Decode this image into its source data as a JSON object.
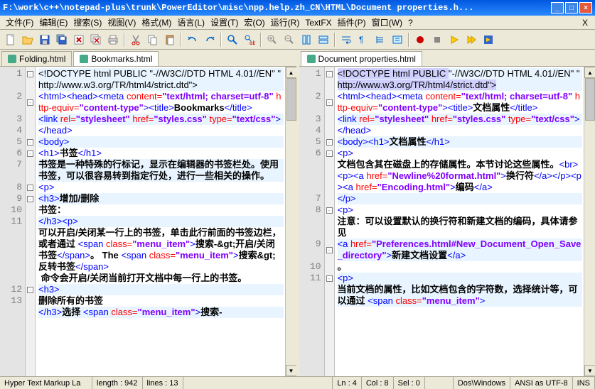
{
  "title": "F:\\work\\c++\\notepad-plus\\trunk\\PowerEditor\\misc\\npp.help.zh_CN\\HTML\\Document properties.h...",
  "menus": [
    "文件(F)",
    "编辑(E)",
    "搜索(S)",
    "视图(V)",
    "格式(M)",
    "语言(L)",
    "设置(T)",
    "宏(O)",
    "运行(R)",
    "TextFX",
    "插件(P)",
    "窗口(W)",
    "?"
  ],
  "tabs_left": [
    {
      "label": "Folding.html",
      "active": false
    },
    {
      "label": "Bookmarks.html",
      "active": true
    }
  ],
  "tabs_right": [
    {
      "label": "Document properties.html",
      "active": true
    }
  ],
  "status": {
    "lang": "Hyper Text Markup La",
    "length": "length : 942",
    "lines": "lines : 13",
    "ln": "Ln : 4",
    "col": "Col : 8",
    "sel": "Sel : 0",
    "eol": "Dos\\Windows",
    "enc": "ANSI as UTF-8",
    "mode": "INS"
  },
  "left_code": [
    {
      "n": 1,
      "alt": true,
      "fold": "-",
      "segs": [
        {
          "c": "t-doc",
          "t": "<!DOCTYPE html PUBLIC \"-//W3C//DTD HTML 4.01//EN\" \""
        }
      ]
    },
    {
      "n": "",
      "alt": true,
      "segs": [
        {
          "c": "t-doc",
          "t": "http://www.w3.org/TR/html4/strict.dtd\">"
        }
      ]
    },
    {
      "n": 2,
      "alt": false,
      "fold": "-",
      "segs": [
        {
          "c": "t-tag",
          "t": "<html><head><meta"
        },
        {
          "c": "",
          "t": " "
        },
        {
          "c": "t-attr",
          "t": "content="
        },
        {
          "c": "t-str",
          "t": "\"text/html; charset=utf-8\""
        },
        {
          "c": "",
          "t": " "
        },
        {
          "c": "t-attr",
          "t": "http-equiv="
        },
        {
          "c": "t-str",
          "t": "\"content-type\""
        },
        {
          "c": "t-tag",
          "t": "><title>"
        },
        {
          "c": "t-txt",
          "t": "Bookmarks"
        },
        {
          "c": "t-tag",
          "t": "</title>"
        }
      ]
    },
    {
      "n": 3,
      "alt": true,
      "segs": [
        {
          "c": "t-tag",
          "t": "<link"
        },
        {
          "c": "",
          "t": " "
        },
        {
          "c": "t-attr",
          "t": "rel="
        },
        {
          "c": "t-str",
          "t": "\"stylesheet\""
        },
        {
          "c": "",
          "t": " "
        },
        {
          "c": "t-attr",
          "t": "href="
        },
        {
          "c": "t-str",
          "t": "\"styles.css\""
        },
        {
          "c": "",
          "t": " "
        },
        {
          "c": "t-attr",
          "t": "type="
        },
        {
          "c": "t-str",
          "t": "\"text/css\""
        },
        {
          "c": "t-tag",
          "t": ">"
        }
      ]
    },
    {
      "n": 4,
      "alt": false,
      "segs": [
        {
          "c": "t-tag",
          "t": "</head>"
        }
      ]
    },
    {
      "n": 5,
      "alt": true,
      "fold": "-",
      "segs": [
        {
          "c": "t-tag",
          "t": "<body>"
        }
      ]
    },
    {
      "n": 6,
      "alt": false,
      "fold": "-",
      "segs": [
        {
          "c": "t-tag",
          "t": "<h1>"
        },
        {
          "c": "t-txt",
          "t": "书签"
        },
        {
          "c": "t-tag",
          "t": "</h1>"
        }
      ]
    },
    {
      "n": 7,
      "alt": true,
      "segs": [
        {
          "c": "t-txt",
          "t": "书签是一种特殊的行标记，显示在编辑器的书签栏处。使用书签，可以很容易转到指定行处，进行一些相关的操作。"
        }
      ]
    },
    {
      "n": 8,
      "alt": false,
      "fold": "-",
      "segs": [
        {
          "c": "t-tag",
          "t": "<p>"
        }
      ]
    },
    {
      "n": 9,
      "alt": true,
      "fold": "-",
      "segs": [
        {
          "c": "t-tag",
          "t": "<h3>"
        },
        {
          "c": "t-txt",
          "t": "增加/删除"
        }
      ]
    },
    {
      "n": 10,
      "alt": false,
      "segs": [
        {
          "c": "t-txt",
          "t": "书签："
        }
      ]
    },
    {
      "n": 11,
      "alt": true,
      "segs": [
        {
          "c": "t-tag",
          "t": "</h3><p>"
        }
      ]
    },
    {
      "n": "",
      "alt": false,
      "segs": [
        {
          "c": "t-txt",
          "t": "可以开启/关闭某一行上的书签，单击此行前面的书签边栏，或者通过 "
        },
        {
          "c": "t-tag",
          "t": "<span"
        },
        {
          "c": "",
          "t": " "
        },
        {
          "c": "t-attr",
          "t": "class="
        },
        {
          "c": "t-str",
          "t": "\"menu_item\""
        },
        {
          "c": "t-tag",
          "t": ">"
        },
        {
          "c": "t-txt",
          "t": "搜索-&gt;开启/关闭书签"
        },
        {
          "c": "t-tag",
          "t": "</span>"
        },
        {
          "c": "t-txt",
          "t": "。 The "
        },
        {
          "c": "t-tag",
          "t": "<span"
        },
        {
          "c": "",
          "t": " "
        },
        {
          "c": "t-attr",
          "t": "class="
        },
        {
          "c": "t-str",
          "t": "\"menu_item\""
        },
        {
          "c": "t-tag",
          "t": ">"
        },
        {
          "c": "t-txt",
          "t": "搜索&gt;反转书签"
        },
        {
          "c": "t-tag",
          "t": "</span>"
        }
      ]
    },
    {
      "n": "",
      "alt": false,
      "segs": [
        {
          "c": "t-txt",
          "t": " 命令会开启/关闭当前打开文档中每一行上的书签。"
        }
      ]
    },
    {
      "n": 12,
      "alt": true,
      "fold": "-",
      "segs": [
        {
          "c": "t-tag",
          "t": "<h3>"
        }
      ]
    },
    {
      "n": 13,
      "alt": false,
      "segs": [
        {
          "c": "t-txt",
          "t": "删除所有的书签"
        }
      ]
    },
    {
      "n": "",
      "alt": true,
      "segs": [
        {
          "c": "t-tag",
          "t": "</h3>"
        },
        {
          "c": "t-txt",
          "t": "选择 "
        },
        {
          "c": "t-tag",
          "t": "<span"
        },
        {
          "c": "",
          "t": " "
        },
        {
          "c": "t-attr",
          "t": "class="
        },
        {
          "c": "t-str",
          "t": "\"menu_item\""
        },
        {
          "c": "t-tag",
          "t": ">"
        },
        {
          "c": "t-txt",
          "t": "搜索-"
        }
      ]
    }
  ],
  "right_code": [
    {
      "n": 1,
      "alt": true,
      "fold": "-",
      "segs": [
        {
          "c": "t-doc t-doc-hl",
          "t": "<!DOCTYPE html PUBLIC "
        },
        {
          "c": "t-doc",
          "t": "\"-//W3C//DTD HTML 4.01//EN\" \""
        }
      ]
    },
    {
      "n": "",
      "alt": true,
      "segs": [
        {
          "c": "t-doc t-doc-hl",
          "t": "http://www.w3.org/TR/html4/strict.dtd\">"
        }
      ]
    },
    {
      "n": 2,
      "alt": false,
      "fold": "-",
      "segs": [
        {
          "c": "t-tag",
          "t": "<html><head><meta"
        },
        {
          "c": "",
          "t": " "
        },
        {
          "c": "t-attr",
          "t": "content="
        },
        {
          "c": "t-str",
          "t": "\"text/html; charset=utf-8\""
        },
        {
          "c": "",
          "t": " "
        },
        {
          "c": "t-attr",
          "t": "http-equiv="
        },
        {
          "c": "t-str",
          "t": "\"content-type\""
        },
        {
          "c": "t-tag",
          "t": "><title>"
        },
        {
          "c": "t-txt",
          "t": "文档属性"
        },
        {
          "c": "t-tag",
          "t": "</title>"
        }
      ]
    },
    {
      "n": 3,
      "alt": true,
      "segs": [
        {
          "c": "t-tag",
          "t": "<link"
        },
        {
          "c": "",
          "t": " "
        },
        {
          "c": "t-attr",
          "t": "rel="
        },
        {
          "c": "t-str",
          "t": "\"stylesheet\""
        },
        {
          "c": "",
          "t": " "
        },
        {
          "c": "t-attr",
          "t": "href="
        },
        {
          "c": "t-str",
          "t": "\"styles.css\""
        },
        {
          "c": "",
          "t": " "
        },
        {
          "c": "t-attr",
          "t": "type="
        },
        {
          "c": "t-str",
          "t": "\"text/css\""
        },
        {
          "c": "t-tag",
          "t": ">"
        }
      ]
    },
    {
      "n": 4,
      "alt": false,
      "segs": [
        {
          "c": "t-tag",
          "t": "</head>"
        }
      ]
    },
    {
      "n": 5,
      "alt": true,
      "fold": "-",
      "segs": [
        {
          "c": "t-tag",
          "t": "<body><h1>"
        },
        {
          "c": "t-txt",
          "t": "文档属性"
        },
        {
          "c": "t-tag",
          "t": "</h1>"
        }
      ]
    },
    {
      "n": 6,
      "alt": false,
      "fold": "-",
      "segs": [
        {
          "c": "t-tag",
          "t": "<p>"
        }
      ]
    },
    {
      "n": "",
      "alt": false,
      "segs": [
        {
          "c": "t-txt",
          "t": "文档包含其在磁盘上的存储属性。本节讨论这些属性。"
        },
        {
          "c": "t-tag",
          "t": "<br><p><a"
        },
        {
          "c": "",
          "t": " "
        },
        {
          "c": "t-attr",
          "t": "href="
        },
        {
          "c": "t-str",
          "t": "\"Newline%20format.html\""
        },
        {
          "c": "t-tag",
          "t": ">"
        },
        {
          "c": "t-txt",
          "t": "换行符"
        },
        {
          "c": "t-tag",
          "t": "</a></p><p><a"
        },
        {
          "c": "",
          "t": " "
        },
        {
          "c": "t-attr",
          "t": "href="
        },
        {
          "c": "t-str",
          "t": "\"Encoding.html\""
        },
        {
          "c": "t-tag",
          "t": ">"
        },
        {
          "c": "t-txt",
          "t": "编码"
        },
        {
          "c": "t-tag",
          "t": "</a>"
        }
      ]
    },
    {
      "n": 7,
      "alt": true,
      "segs": [
        {
          "c": "t-tag",
          "t": "</p>"
        }
      ]
    },
    {
      "n": 8,
      "alt": false,
      "fold": "-",
      "segs": [
        {
          "c": "t-tag",
          "t": "<p>"
        }
      ]
    },
    {
      "n": "",
      "alt": false,
      "segs": [
        {
          "c": "t-txt",
          "t": "注意：可以设置默认的换行符和新建文档的编码，具体请参见"
        }
      ]
    },
    {
      "n": 9,
      "alt": true,
      "fold": "-",
      "segs": [
        {
          "c": "t-tag",
          "t": "<a"
        },
        {
          "c": "",
          "t": " "
        },
        {
          "c": "t-attr",
          "t": "href="
        },
        {
          "c": "t-str",
          "t": "\"Preferences.html#New_Document_Open_Save_directory\""
        },
        {
          "c": "t-tag",
          "t": ">"
        },
        {
          "c": "t-txt",
          "t": "新建文档设置"
        },
        {
          "c": "t-tag",
          "t": "</a>"
        }
      ]
    },
    {
      "n": 10,
      "alt": false,
      "segs": [
        {
          "c": "t-txt",
          "t": "。"
        }
      ]
    },
    {
      "n": 11,
      "alt": true,
      "fold": "-",
      "segs": [
        {
          "c": "t-tag",
          "t": "<p>"
        }
      ]
    },
    {
      "n": "",
      "alt": true,
      "segs": [
        {
          "c": "t-txt",
          "t": "当前文档的属性，比如文档包含的字符数，选择统计等，可以通过 "
        },
        {
          "c": "t-tag",
          "t": "<span"
        },
        {
          "c": "",
          "t": " "
        },
        {
          "c": "t-attr",
          "t": "class="
        },
        {
          "c": "t-str",
          "t": "\"menu_item\""
        },
        {
          "c": "t-tag",
          "t": ">"
        }
      ]
    }
  ]
}
